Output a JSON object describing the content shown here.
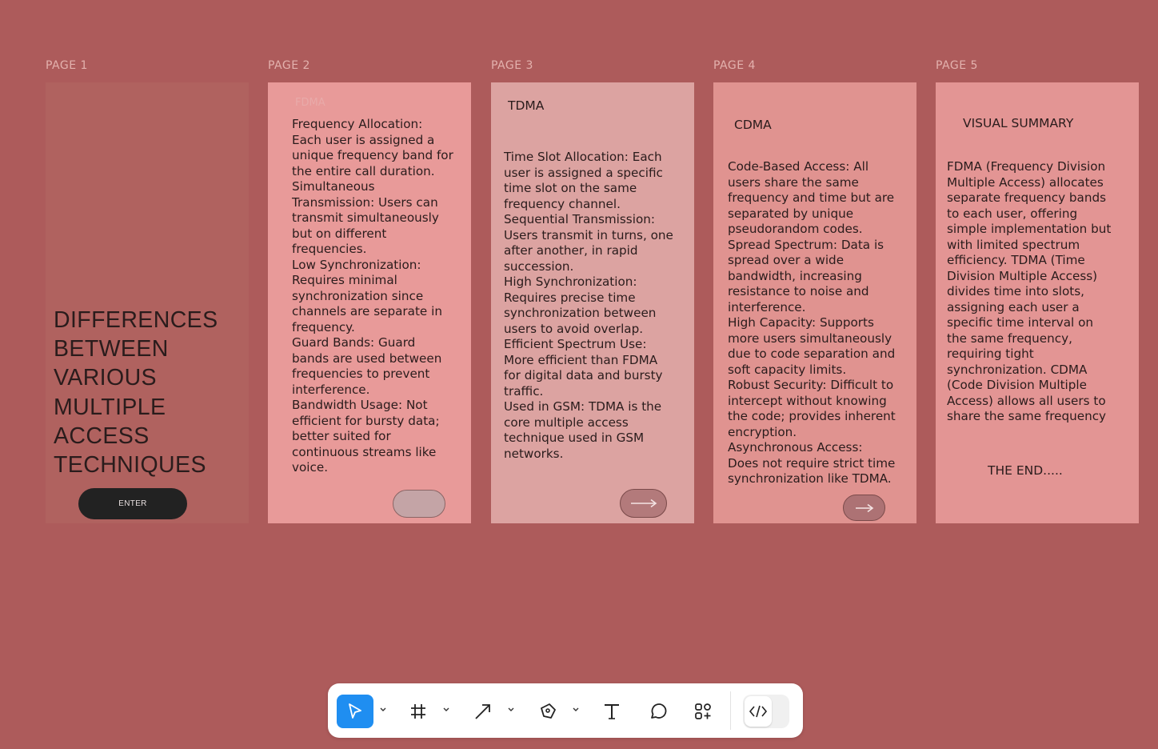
{
  "pages": [
    {
      "label": "PAGE 1",
      "title_lines": [
        "DIFFERENCES",
        "BETWEEN",
        "VARIOUS",
        "MULTIPLE",
        "ACCESS",
        "TECHNIQUES"
      ],
      "button_label": "ENTER"
    },
    {
      "label": "PAGE 2",
      "heading": "FDMA",
      "lines": [
        "Frequency Allocation:",
        "Each user is assigned a",
        "unique frequency band for",
        "the entire call duration.",
        "Simultaneous",
        "Transmission: Users can",
        "transmit simultaneously",
        "but on different",
        "frequencies.",
        "Low Synchronization:",
        "Requires minimal",
        "synchronization since",
        "channels are separate in",
        "frequency.",
        "Guard Bands: Guard",
        "bands are used between",
        "frequencies to prevent",
        "interference.",
        "Bandwidth Usage: Not",
        "efficient for bursty data;",
        "better suited for",
        "continuous streams like",
        "voice."
      ]
    },
    {
      "label": "PAGE 3",
      "heading": "TDMA",
      "lines": [
        "Time Slot Allocation: Each",
        "user is assigned a specific",
        "time slot on the same",
        "frequency channel.",
        "Sequential Transmission:",
        "Users transmit in turns, one",
        "after another, in rapid",
        "succession.",
        "High Synchronization:",
        "Requires precise time",
        "synchronization between",
        "users to avoid overlap.",
        "Efficient Spectrum Use:",
        "More efficient than FDMA",
        "for digital data and bursty",
        "traffic.",
        "Used in GSM: TDMA is the",
        "core multiple access",
        "technique used in GSM",
        "networks."
      ]
    },
    {
      "label": "PAGE 4",
      "heading": "CDMA",
      "lines": [
        "Code-Based Access: All",
        "users share the same",
        "frequency and time but are",
        "separated by unique",
        "pseudorandom codes.",
        "Spread Spectrum: Data is",
        "spread over a wide",
        "bandwidth, increasing",
        "resistance to noise and",
        "interference.",
        "High Capacity: Supports",
        "more users simultaneously",
        "due to code separation and",
        "soft capacity limits.",
        "Robust Security: Difficult to",
        "intercept without knowing",
        "the code; provides inherent",
        "encryption.",
        "Asynchronous Access:",
        "Does not require strict time",
        "synchronization like TDMA."
      ]
    },
    {
      "label": "PAGE 5",
      "heading": "VISUAL SUMMARY",
      "lines": [
        "FDMA (Frequency Division",
        "Multiple Access) allocates",
        "separate frequency bands",
        "to each user, offering",
        "simple implementation but",
        "with limited spectrum",
        "efficiency. TDMA (Time",
        "Division Multiple Access)",
        "divides time into slots,",
        "assigning each user a",
        "specific time interval on",
        "the same frequency,",
        "requiring tight",
        "synchronization. CDMA",
        "(Code Division Multiple",
        "Access) allows all users to",
        "share the same frequency"
      ],
      "footer": "THE END....."
    }
  ],
  "toolbar": {
    "tools": [
      "move-tool",
      "frame-tool",
      "arrow-tool",
      "pen-tool",
      "text-tool",
      "comment-tool",
      "assets-tool",
      "dev-mode-toggle"
    ],
    "active_tool": "move-tool",
    "accent_color": "#1f8ef1"
  },
  "colors": {
    "canvas": "#ad5b5b",
    "page1": "#b0625f",
    "page2": "#e89a99",
    "page3": "#dca3a1",
    "page4": "#e09390",
    "page5": "#e39594"
  }
}
